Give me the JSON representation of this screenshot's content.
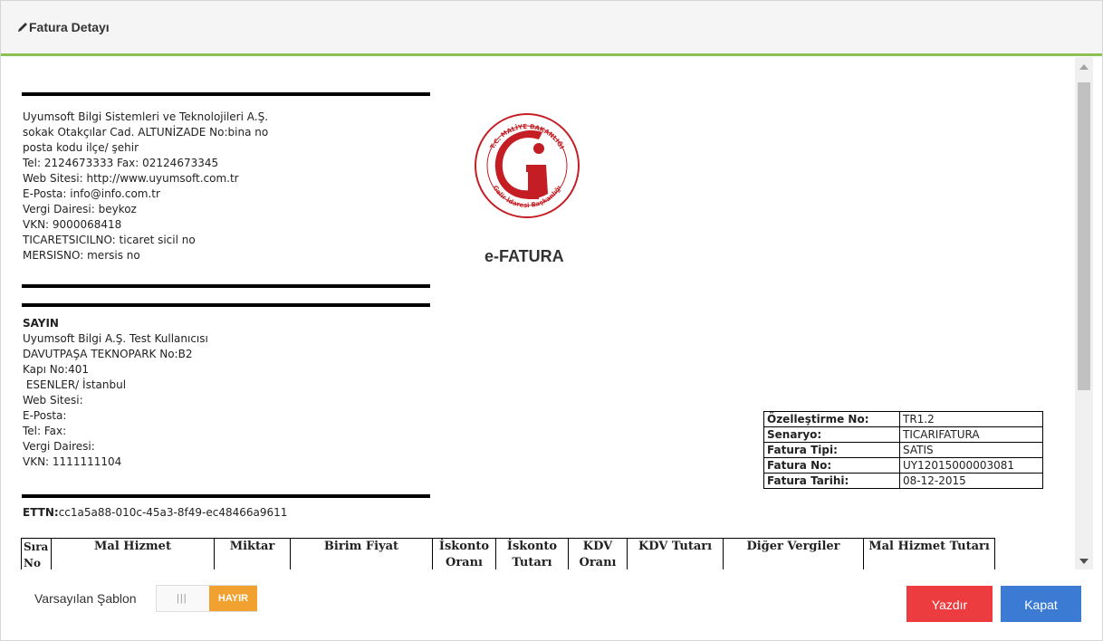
{
  "modal": {
    "title": "Fatura Detayı"
  },
  "seller": {
    "lines": [
      "Uyumsoft Bilgi Sistemleri ve Teknolojileri A.Ş.",
      "sokak Otakçılar Cad. ALTUNİZADE No:bina no",
      "posta kodu ilçe/ şehir",
      "Tel: 2124673333 Fax: 02124673345",
      "Web Sitesi: http://www.uyumsoft.com.tr",
      "E-Posta: info@info.com.tr",
      "Vergi Dairesi: beykoz",
      "VKN: 9000068418",
      "TICARETSICILNO: ticaret sicil no",
      "MERSISNO: mersis no"
    ]
  },
  "logo": {
    "top_text": "T.C. MALİYE BAKANLIĞI",
    "bottom_text": "Gelir İdaresi Başkanlığı"
  },
  "document_title": "e-FATURA",
  "buyer": {
    "heading": "SAYIN",
    "lines": [
      "Uyumsoft Bilgi A.Ş. Test Kullanıcısı",
      "DAVUTPAŞA TEKNOPARK No:B2",
      "Kapı No:401",
      " ESENLER/ İstanbul",
      "Web Sitesi:",
      "E-Posta:",
      "Tel: Fax:",
      "Vergi Dairesi:",
      "VKN: 1111111104"
    ]
  },
  "invoice_meta": [
    {
      "key": "Özelleştirme No:",
      "value": "TR1.2"
    },
    {
      "key": "Senaryo:",
      "value": "TICARIFATURA"
    },
    {
      "key": "Fatura Tipi:",
      "value": "SATIS"
    },
    {
      "key": "Fatura No:",
      "value": "UY12015000003081"
    },
    {
      "key": "Fatura Tarihi:",
      "value": "08-12-2015"
    }
  ],
  "ettn": {
    "label": "ETTN:",
    "value": "cc1a5a88-010c-45a3-8f49-ec48466a9611"
  },
  "items_table": {
    "headers": [
      "Sıra No",
      "Mal Hizmet",
      "Miktar",
      "Birim Fiyat",
      "İskonto Oranı",
      "İskonto Tutarı",
      "KDV Oranı",
      "KDV Tutarı",
      "Diğer Vergiler",
      "Mal Hizmet Tutarı"
    ]
  },
  "footer": {
    "template_label": "Varsayılan Şablon",
    "toggle_handle": "|||",
    "toggle_state": "HAYIR",
    "print_label": "Yazdır",
    "close_label": "Kapat"
  },
  "colors": {
    "header_accent": "#8cc152",
    "print_button": "#ed3c3f",
    "close_button": "#3b7bd4",
    "toggle_off": "#f0a12f"
  }
}
